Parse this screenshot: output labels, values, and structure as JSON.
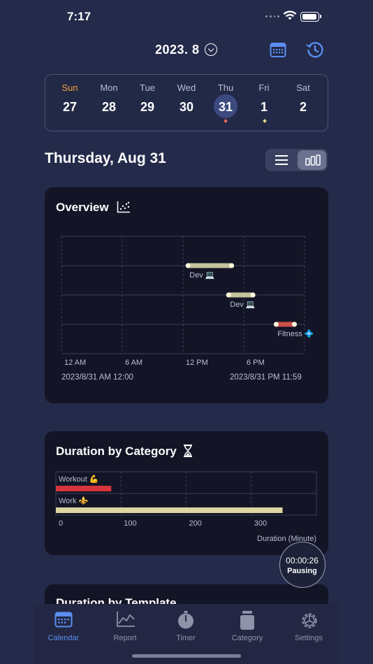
{
  "status": {
    "time": "7:17"
  },
  "header": {
    "month": "2023. 8"
  },
  "week": [
    {
      "name": "Sun",
      "num": "27"
    },
    {
      "name": "Mon",
      "num": "28"
    },
    {
      "name": "Tue",
      "num": "29"
    },
    {
      "name": "Wed",
      "num": "30"
    },
    {
      "name": "Thu",
      "num": "31"
    },
    {
      "name": "Fri",
      "num": "1"
    },
    {
      "name": "Sat",
      "num": "2"
    }
  ],
  "date_title": "Thursday, Aug 31",
  "overview": {
    "title": "Overview",
    "x_ticks": [
      "12 AM",
      "6 AM",
      "12 PM",
      "6 PM"
    ],
    "range_start": "2023/8/31 AM 12:00",
    "range_end": "2023/8/31 PM 11:59",
    "bars": [
      {
        "label": "Dev 💻",
        "start_hour": 12.5,
        "end_hour": 16.8,
        "color": "#d8d5a8"
      },
      {
        "label": "Dev 💻",
        "start_hour": 16.5,
        "end_hour": 18.9,
        "color": "#d8d5a8"
      },
      {
        "label": "Fitness 💠",
        "start_hour": 21.2,
        "end_hour": 23.0,
        "color": "#e0574f"
      }
    ]
  },
  "duration": {
    "title": "Duration by Category",
    "x_ticks": [
      "0",
      "100",
      "200",
      "300"
    ],
    "x_label": "Duration (Minute)",
    "categories": [
      {
        "label": "Workout 💪",
        "minutes": 85,
        "color": "#d8343b"
      },
      {
        "label": "Work ⚜️",
        "minutes": 348,
        "color": "#dcd6a2"
      }
    ]
  },
  "template_card": {
    "title": "Duration by Template"
  },
  "timer": {
    "time": "00:00:26",
    "state": "Pausing"
  },
  "tabs": [
    {
      "label": "Calendar",
      "icon": "calendar-icon"
    },
    {
      "label": "Report",
      "icon": "chart-icon"
    },
    {
      "label": "Timer",
      "icon": "stopwatch-icon"
    },
    {
      "label": "Category",
      "icon": "jar-icon"
    },
    {
      "label": "Settings",
      "icon": "gear-icon"
    }
  ],
  "colors": {
    "accent": "#5a8ef0",
    "sunday": "#f2a33a",
    "background": "#232a4a",
    "card": "#131526"
  }
}
